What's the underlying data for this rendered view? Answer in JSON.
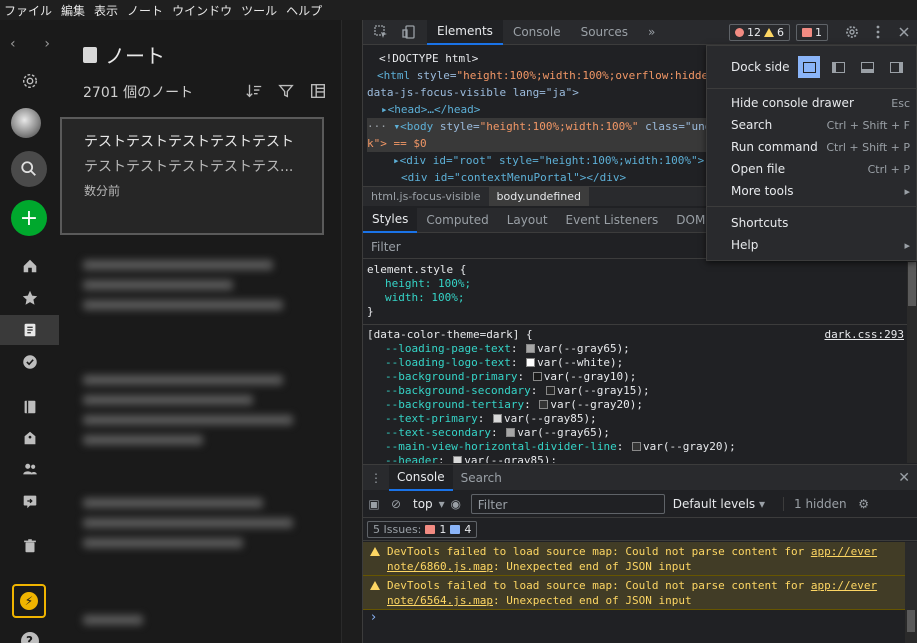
{
  "menubar": [
    "ファイル",
    "編集",
    "表示",
    "ノート",
    "ウインドウ",
    "ツール",
    "ヘルプ"
  ],
  "rail": {
    "back": "‹",
    "forward": "›",
    "add": "+",
    "help": "?"
  },
  "notes": {
    "title": "ノート",
    "count": "2701 個のノート",
    "card": {
      "title": "テストテストテストテストテスト",
      "preview": "テストテストテストテストテス...",
      "date": "数分前"
    }
  },
  "devtools": {
    "tabs": [
      "Elements",
      "Console",
      "Sources"
    ],
    "more_tabs": "»",
    "errors": "12",
    "warnings": "6",
    "issues_badge": "1",
    "dom_lines": {
      "l1": "<!DOCTYPE html>",
      "l2_tag": "<html",
      "l2_attr": " style=",
      "l2_val": "\"height:100%;width:100%;overflow:hidde",
      "l3": "data-js-focus-visible lang=\"ja\">",
      "l4": "▸<head>…</head>",
      "l5_tag": "▾<body",
      "l5_attr": " style=",
      "l5_val": "\"height:100%;width:100%\"",
      "l5_rest": " class=\"unde",
      "l6": "k\"> == $0",
      "l7": "▸<div id=\"root\" style=\"height:100%;width:100%\">",
      "l8": "<div id=\"contextMenuPortal\"></div>"
    },
    "breadcrumb": [
      "html.js-focus-visible",
      "body.undefined"
    ],
    "style_tabs": [
      "Styles",
      "Computed",
      "Layout",
      "Event Listeners",
      "DOM Brea"
    ],
    "filter_placeholder": "Filter",
    "styles": {
      "element_style": "element.style {",
      "height": "height: 100%;",
      "width": "width: 100%;",
      "close": "}",
      "rule_selector": "[data-color-theme=dark] {",
      "rule_link": "dark.css:293",
      "vars": [
        {
          "prop": "--loading-page-text",
          "val": "var(--gray65);",
          "color": "#a6a6a6"
        },
        {
          "prop": "--loading-logo-text",
          "val": "var(--white);",
          "color": "#ffffff"
        },
        {
          "prop": "--background-primary",
          "val": "var(--gray10);",
          "color": "#1a1a1a"
        },
        {
          "prop": "--background-secondary",
          "val": "var(--gray15);",
          "color": "#262626"
        },
        {
          "prop": "--background-tertiary",
          "val": "var(--gray20);",
          "color": "#333333"
        },
        {
          "prop": "--text-primary",
          "val": "var(--gray85);",
          "color": "#d9d9d9"
        },
        {
          "prop": "--text-secondary",
          "val": "var(--gray65);",
          "color": "#a6a6a6"
        },
        {
          "prop": "--main-view-horizontal-divider-line",
          "val": "var(--gray20);",
          "color": "#333333"
        },
        {
          "prop": "--header",
          "val": "var(--gray85);",
          "color": "#d9d9d9"
        }
      ]
    },
    "drawer": {
      "tabs": [
        "Console",
        "Search"
      ],
      "context": "top",
      "filter_placeholder": "Filter",
      "levels": "Default levels",
      "hidden": "1 hidden",
      "issues_label": "5 Issues:",
      "issues_err": "1",
      "issues_info": "4",
      "messages": [
        {
          "text": "DevTools failed to load source map: Could not parse content for ",
          "link1": "app://ever",
          "link2": "note/6860.js.map",
          "tail": ": Unexpected end of JSON input"
        },
        {
          "text": "DevTools failed to load source map: Could not parse content for ",
          "link1": "app://ever",
          "link2": "note/6564.js.map",
          "tail": ": Unexpected end of JSON input"
        }
      ],
      "prompt": "›"
    },
    "menu": {
      "dock_side": "Dock side",
      "items": [
        {
          "label": "Hide console drawer",
          "key": "Esc"
        },
        {
          "label": "Search",
          "key": "Ctrl + Shift + F"
        },
        {
          "label": "Run command",
          "key": "Ctrl + Shift + P"
        },
        {
          "label": "Open file",
          "key": "Ctrl + P"
        },
        {
          "label": "More tools",
          "key": "▸"
        },
        {
          "label": "Shortcuts",
          "key": ""
        },
        {
          "label": "Help",
          "key": "▸"
        }
      ]
    }
  }
}
